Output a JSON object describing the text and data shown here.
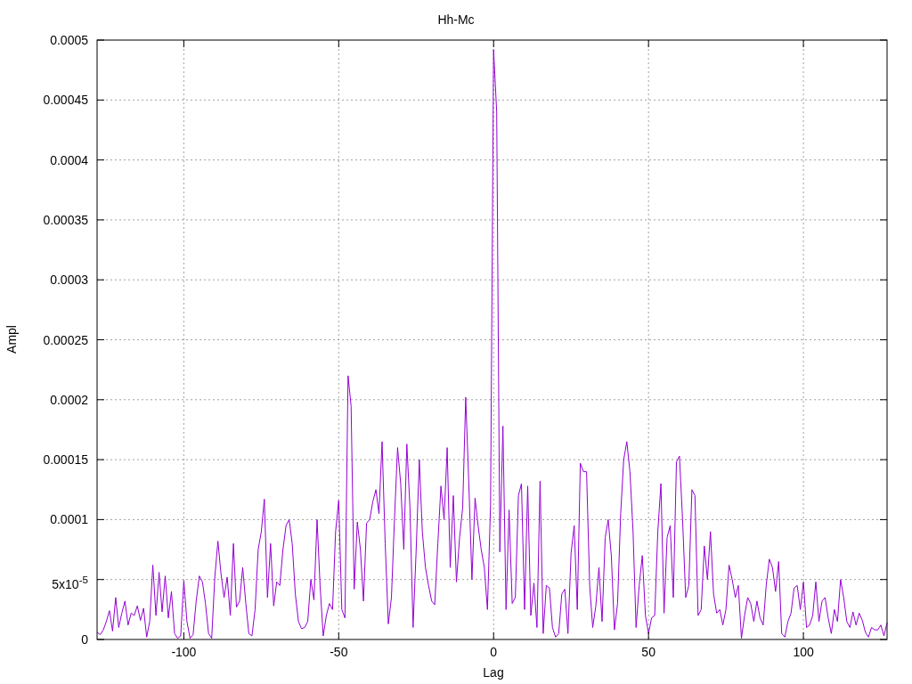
{
  "plot": {
    "chart_data": {
      "type": "line",
      "title": "Hh-Mc",
      "xlabel": "Lag",
      "ylabel": "Ampl",
      "grid": true,
      "xlim": [
        -128,
        127
      ],
      "ylim": [
        0,
        0.0005
      ],
      "xticks": [
        -100,
        -50,
        0,
        50,
        100
      ],
      "yticks": [
        {
          "value": 0,
          "label": "0"
        },
        {
          "value": 5e-05,
          "label": "5x10$^{-5}$"
        },
        {
          "value": 0.0001,
          "label": "0.0001"
        },
        {
          "value": 0.00015,
          "label": "0.00015"
        },
        {
          "value": 0.0002,
          "label": "0.0002"
        },
        {
          "value": 0.00025,
          "label": "0.00025"
        },
        {
          "value": 0.0003,
          "label": "0.0003"
        },
        {
          "value": 0.00035,
          "label": "0.00035"
        },
        {
          "value": 0.0004,
          "label": "0.0004"
        },
        {
          "value": 0.00045,
          "label": "0.00045"
        },
        {
          "value": 0.0005,
          "label": "0.0005"
        }
      ],
      "x": [
        -128,
        -127,
        -126,
        -125,
        -124,
        -123,
        -122,
        -121,
        -120,
        -119,
        -118,
        -117,
        -116,
        -115,
        -114,
        -113,
        -112,
        -111,
        -110,
        -109,
        -108,
        -107,
        -106,
        -105,
        -104,
        -103,
        -102,
        -101,
        -100,
        -99,
        -98,
        -97,
        -96,
        -95,
        -94,
        -93,
        -92,
        -91,
        -90,
        -89,
        -88,
        -87,
        -86,
        -85,
        -84,
        -83,
        -82,
        -81,
        -80,
        -79,
        -78,
        -77,
        -76,
        -75,
        -74,
        -73,
        -72,
        -71,
        -70,
        -69,
        -68,
        -67,
        -66,
        -65,
        -64,
        -63,
        -62,
        -61,
        -60,
        -59,
        -58,
        -57,
        -56,
        -55,
        -54,
        -53,
        -52,
        -51,
        -50,
        -49,
        -48,
        -47,
        -46,
        -45,
        -44,
        -43,
        -42,
        -41,
        -40,
        -39,
        -38,
        -37,
        -36,
        -35,
        -34,
        -33,
        -32,
        -31,
        -30,
        -29,
        -28,
        -27,
        -26,
        -25,
        -24,
        -23,
        -22,
        -21,
        -20,
        -19,
        -18,
        -17,
        -16,
        -15,
        -14,
        -13,
        -12,
        -11,
        -10,
        -9,
        -8,
        -7,
        -6,
        -5,
        -4,
        -3,
        -2,
        -1,
        0,
        1,
        2,
        3,
        4,
        5,
        6,
        7,
        8,
        9,
        10,
        11,
        12,
        13,
        14,
        15,
        16,
        17,
        18,
        19,
        20,
        21,
        22,
        23,
        24,
        25,
        26,
        27,
        28,
        29,
        30,
        31,
        32,
        33,
        34,
        35,
        36,
        37,
        38,
        39,
        40,
        41,
        42,
        43,
        44,
        45,
        46,
        47,
        48,
        49,
        50,
        51,
        52,
        53,
        54,
        55,
        56,
        57,
        58,
        59,
        60,
        61,
        62,
        63,
        64,
        65,
        66,
        67,
        68,
        69,
        70,
        71,
        72,
        73,
        74,
        75,
        76,
        77,
        78,
        79,
        80,
        81,
        82,
        83,
        84,
        85,
        86,
        87,
        88,
        89,
        90,
        91,
        92,
        93,
        94,
        95,
        96,
        97,
        98,
        99,
        100,
        101,
        102,
        103,
        104,
        105,
        106,
        107,
        108,
        109,
        110,
        111,
        112,
        113,
        114,
        115,
        116,
        117,
        118,
        119,
        120,
        121,
        122,
        123,
        124,
        125,
        126,
        127
      ],
      "series": [
        {
          "color": "#9400d3",
          "values": [
            6e-06,
            4e-06,
            8e-06,
            1.5e-05,
            2.4e-05,
            7e-06,
            3.5e-05,
            1e-05,
            2.2e-05,
            3.2e-05,
            1.2e-05,
            2.2e-05,
            2e-05,
            2.8e-05,
            1.6e-05,
            2.6e-05,
            2e-06,
            1.5e-05,
            6.2e-05,
            2e-05,
            5.6e-05,
            2.3e-05,
            5.3e-05,
            1.8e-05,
            4e-05,
            5e-06,
            1e-06,
            3e-06,
            4.9e-05,
            1.5e-05,
            1e-06,
            4e-06,
            3.2e-05,
            5.3e-05,
            4.8e-05,
            3e-05,
            5e-06,
            1e-06,
            5.2e-05,
            8.2e-05,
            5.5e-05,
            3.5e-05,
            5.2e-05,
            2e-05,
            8e-05,
            2.7e-05,
            3.2e-05,
            6e-05,
            3e-05,
            5e-06,
            3e-06,
            2.5e-05,
            7.5e-05,
            9e-05,
            0.000117,
            3.5e-05,
            8e-05,
            2.8e-05,
            4.8e-05,
            4.5e-05,
            7.5e-05,
            9.5e-05,
            0.0001,
            8e-05,
            3.8e-05,
            1.5e-05,
            9e-06,
            1e-05,
            1.5e-05,
            5e-05,
            3.3e-05,
            0.0001,
            4.5e-05,
            3e-06,
            2e-05,
            3e-05,
            2.5e-05,
            9e-05,
            0.000116,
            2.5e-05,
            1.8e-05,
            0.00022,
            0.000195,
            4.2e-05,
            9.8e-05,
            7.5e-05,
            3.2e-05,
            9.7e-05,
            0.0001,
            0.000115,
            0.000125,
            0.000105,
            0.000165,
            8e-05,
            1.3e-05,
            3.5e-05,
            0.0001,
            0.00016,
            0.00013,
            7.5e-05,
            0.000163,
            0.00011,
            1e-05,
            7.5e-05,
            0.00015,
            9e-05,
            6e-05,
            4.5e-05,
            3.2e-05,
            2.9e-05,
            8e-05,
            0.000128,
            0.0001,
            0.00016,
            6e-05,
            0.00012,
            4.8e-05,
            8.5e-05,
            0.00011,
            0.000202,
            0.00013,
            5e-05,
            0.000118,
            9.5e-05,
            7.5e-05,
            6e-05,
            2.5e-05,
            0.000112,
            0.000492,
            0.00044,
            7.3e-05,
            0.000178,
            2.5e-05,
            0.000108,
            3e-05,
            3.5e-05,
            0.00012,
            0.00013,
            2.5e-05,
            0.000128,
            2e-05,
            4.7e-05,
            1e-05,
            0.000132,
            5e-06,
            4.5e-05,
            4.3e-05,
            1e-05,
            2e-06,
            5e-06,
            3.8e-05,
            4.2e-05,
            5e-06,
            7.2e-05,
            9.5e-05,
            2.5e-05,
            0.000147,
            0.00014,
            0.00014,
            4.5e-05,
            1e-05,
            2.8e-05,
            6e-05,
            1.5e-05,
            8.5e-05,
            0.0001,
            7e-05,
            8e-06,
            3e-05,
            0.000105,
            0.00015,
            0.000165,
            0.00014,
            9e-05,
            1e-05,
            4.5e-05,
            7e-05,
            2e-05,
            5e-06,
            1.8e-05,
            2e-05,
            9e-05,
            0.00013,
            2.2e-05,
            8.5e-05,
            9.5e-05,
            3.5e-05,
            0.000148,
            0.000153,
            0.0001,
            3.5e-05,
            4.5e-05,
            0.000125,
            0.00012,
            2e-05,
            2.5e-05,
            7.8e-05,
            5e-05,
            9e-05,
            3.8e-05,
            2.2e-05,
            2.5e-05,
            1.2e-05,
            2.5e-05,
            6.2e-05,
            5e-05,
            3.5e-05,
            4.5e-05,
            1e-06,
            2e-05,
            3.5e-05,
            3e-05,
            1.5e-05,
            3.2e-05,
            1.8e-05,
            1.2e-05,
            4.5e-05,
            6.7e-05,
            6e-05,
            4e-05,
            6.5e-05,
            5e-06,
            2e-06,
            1.5e-05,
            2.2e-05,
            4.3e-05,
            4.5e-05,
            2.5e-05,
            4.8e-05,
            1e-05,
            1.2e-05,
            2e-05,
            4.8e-05,
            1.5e-05,
            3.2e-05,
            3.5e-05,
            1.8e-05,
            5e-06,
            2.5e-05,
            1.5e-05,
            5e-05,
            3.5e-05,
            1.5e-05,
            1e-05,
            2.3e-05,
            1.2e-05,
            2.2e-05,
            1.6e-05,
            6e-06,
            2e-06,
            1e-05,
            8e-06,
            8e-06,
            1.2e-05,
            3e-06,
            1.4e-05
          ]
        }
      ]
    }
  }
}
